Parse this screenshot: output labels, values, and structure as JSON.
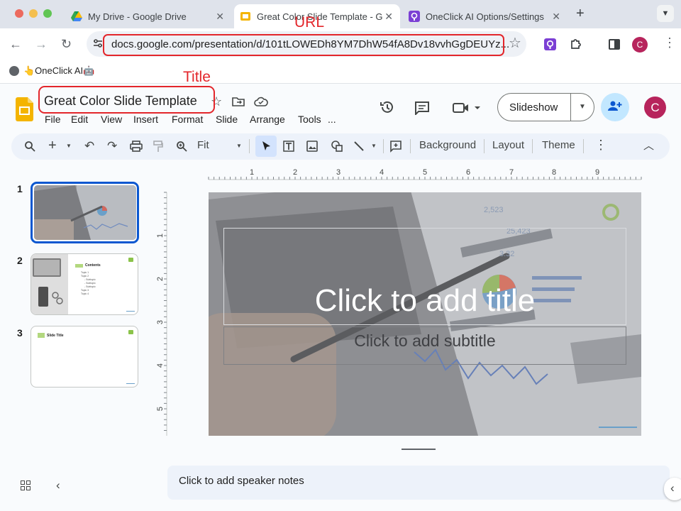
{
  "browser": {
    "tabs": [
      {
        "title": "My Drive - Google Drive",
        "icon": "google-drive-icon"
      },
      {
        "title": "Great Color Slide Template - G",
        "icon": "google-slides-icon"
      },
      {
        "title": "OneClick AI Options/Settings",
        "icon": "oneclick-ai-icon"
      }
    ],
    "new_tab": "+",
    "url": "docs.google.com/presentation/d/101tLOWEDh8YM7DhW54fA8Dv18vvhGgDEUYz...",
    "profile_letter": "C",
    "bookmarks": [
      {
        "label": "👆OneClick AI🤖"
      }
    ]
  },
  "annotations": {
    "url_label": "URL",
    "title_label": "Title",
    "color": "#e3262b"
  },
  "app": {
    "doc_title": "Great Color Slide Template",
    "menu": [
      "File",
      "Edit",
      "View",
      "Insert",
      "Format",
      "Slide",
      "Arrange",
      "Tools",
      "..."
    ],
    "slideshow_label": "Slideshow",
    "avatar_letter": "C",
    "accent": "#c2e7ff"
  },
  "toolbar": {
    "zoom": "Fit",
    "background": "Background",
    "layout": "Layout",
    "theme": "Theme"
  },
  "ruler": {
    "top_numbers": [
      "1",
      "2",
      "3",
      "4",
      "5",
      "6",
      "7",
      "8",
      "9"
    ],
    "left_numbers": [
      "1",
      "2",
      "3",
      "4",
      "5"
    ]
  },
  "filmstrip": [
    {
      "number": "1",
      "selected": true
    },
    {
      "number": "2",
      "selected": false,
      "heading": "Contents",
      "items": [
        "Topic 1",
        "Topic 2",
        "- Subtopic",
        "- Subtopic",
        "- Subtopic",
        "Topic 3",
        "Topic 4"
      ]
    },
    {
      "number": "3",
      "selected": false,
      "heading": "Slide Title"
    }
  ],
  "slide": {
    "title_placeholder": "Click to add title",
    "subtitle_placeholder": "Click to add subtitle"
  },
  "notes_placeholder": "Click to add speaker notes"
}
